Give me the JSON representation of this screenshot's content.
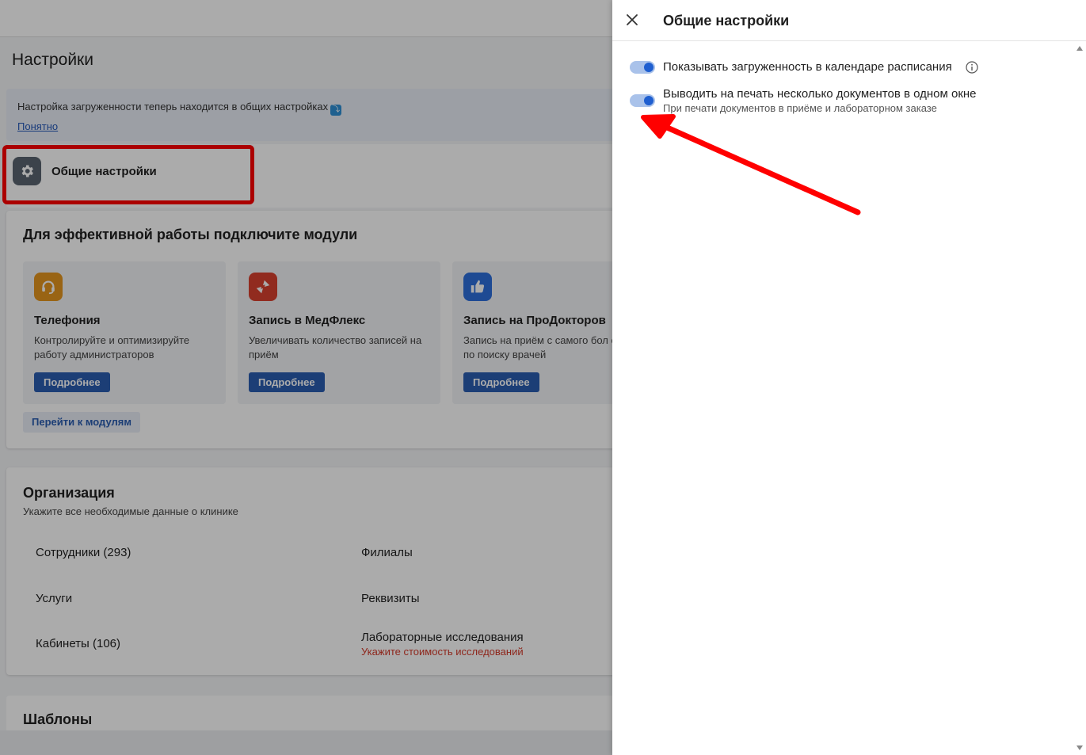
{
  "page": {
    "title": "Настройки",
    "notice": {
      "text": "Настройка загруженности теперь находится в общих настройках",
      "link": "Понятно"
    },
    "general_settings": {
      "label": "Общие настройки"
    },
    "modules": {
      "title": "Для эффективной работы подключите модули",
      "items": [
        {
          "name": "Телефония",
          "description": "Контролируйте и оптимизируйте работу администраторов",
          "button": "Подробнее",
          "icon": "headset-icon",
          "color": "#e5951f"
        },
        {
          "name": "Запись в МедФлекс",
          "description": "Увеличивать количество записей на приём",
          "button": "Подробнее",
          "icon": "swap-arrows-icon",
          "color": "#d8412f"
        },
        {
          "name": "Запись на ПроДокторов",
          "description": "Запись на приём с самого бол сервиса по поиску врачей",
          "button": "Подробнее",
          "icon": "thumbs-up-icon",
          "color": "#2e6fdc"
        }
      ],
      "goto_button": "Перейти к модулям"
    },
    "organization": {
      "title": "Организация",
      "subtitle": "Укажите все необходимые данные о клинике",
      "items": {
        "employees": "Сотрудники (293)",
        "branches": "Филиалы",
        "services": "Услуги",
        "requisites": "Реквизиты",
        "rooms": "Кабинеты (106)",
        "lab": "Лабораторные исследования",
        "lab_warning": "Укажите стоимость исследований"
      }
    },
    "templates": {
      "title": "Шаблоны"
    }
  },
  "drawer": {
    "title": "Общие настройки",
    "settings": [
      {
        "label": "Показывать загруженность в календаре расписания",
        "enabled": true
      },
      {
        "label": "Выводить на печать несколько документов в одном окне",
        "hint": "При печати документов в приёме и лабораторном заказе",
        "enabled": true
      }
    ]
  },
  "colors": {
    "accent": "#2a5db0",
    "toggle_on": "#1f5fd0",
    "annotation": "#ff0000",
    "warning": "#d43a2a"
  }
}
